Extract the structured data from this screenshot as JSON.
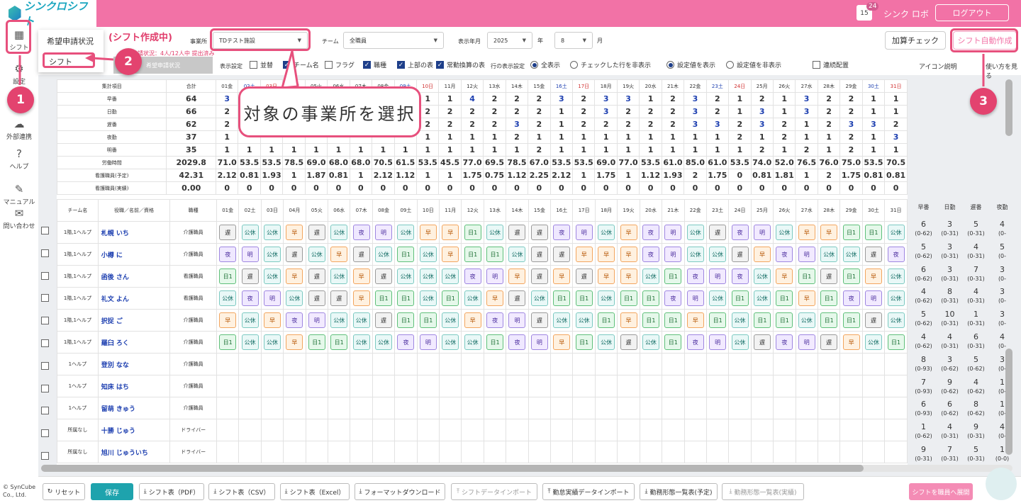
{
  "app": {
    "logo_text": "シンクロシフト",
    "user_name": "シンク ロボ",
    "logout": "ログアウト",
    "notification_count": "24"
  },
  "sidebar": {
    "items": [
      {
        "label": "シフト",
        "icon": "calendar-icon"
      },
      {
        "label": "設定",
        "icon": "gear-icon"
      },
      {
        "label": "外部連携",
        "icon": "cloud-icon"
      },
      {
        "label": "ヘルプ",
        "icon": "help-icon"
      },
      {
        "label": "マニュアル",
        "icon": "pen-icon"
      },
      {
        "label": "問い合わせ",
        "icon": "mail-icon"
      }
    ],
    "copyright_1": "© SynCube",
    "copyright_2": "Co., Ltd."
  },
  "popup": {
    "item1": "希望申請状況",
    "item2": "シフト"
  },
  "header": {
    "page_title": "(シフト作成中)",
    "office_label": "事業所",
    "office_value": "TDテスト施設",
    "team_label": "チーム",
    "team_value": "全職員",
    "month_label": "表示年月",
    "year_value": "2025",
    "year_unit": "年",
    "month_value": "8",
    "month_unit": "月",
    "submit_status": "希望申請状況：4人/12人中 提出済み",
    "sub_tab_inactive": "希望申請状況",
    "display_setting_label": "表示設定",
    "checks": [
      {
        "label": "並替",
        "on": false
      },
      {
        "label": "チーム名",
        "on": true
      },
      {
        "label": "フラグ",
        "on": false
      },
      {
        "label": "職種",
        "on": true
      },
      {
        "label": "上部の表",
        "on": true
      },
      {
        "label": "常勤換算の表",
        "on": true
      }
    ],
    "row_display_label": "行の表示設定",
    "radio_all": "全表示",
    "radio_hide_checked": "チェックした行を非表示",
    "radio_show_set": "設定値を表示",
    "radio_hide_set": "設定値を非表示",
    "consecutive": "連続配置",
    "icon_help": "アイコン説明",
    "how_to": "使い方を見る",
    "btn_calc": "加算チェック",
    "btn_auto": "シフト自動作成"
  },
  "summary": {
    "header_labels": [
      "集計項目",
      "合計"
    ],
    "days": [
      "01金",
      "02土",
      "03日",
      "04月",
      "05火",
      "06水",
      "07木",
      "08金",
      "09土",
      "10日",
      "11月",
      "12火",
      "13水",
      "14木",
      "15金",
      "16土",
      "17日",
      "18月",
      "19火",
      "20水",
      "21木",
      "22金",
      "23土",
      "24日",
      "25月",
      "26火",
      "27水",
      "28木",
      "29金",
      "30土",
      "31日"
    ],
    "rows": [
      {
        "label": "早番",
        "total": "64",
        "vals": [
          "3",
          "",
          "",
          "",
          "",
          "",
          "",
          "",
          "",
          "1",
          "1",
          "4",
          "2",
          "2",
          "2",
          "3",
          "2",
          "3",
          "3",
          "1",
          "2",
          "3",
          "2",
          "1",
          "2",
          "1",
          "3",
          "2",
          "2",
          "1",
          "1"
        ]
      },
      {
        "label": "日勤",
        "total": "66",
        "vals": [
          "2",
          "",
          "",
          "",
          "",
          "",
          "",
          "",
          "",
          "2",
          "2",
          "2",
          "2",
          "2",
          "2",
          "1",
          "2",
          "3",
          "2",
          "2",
          "2",
          "3",
          "2",
          "1",
          "3",
          "1",
          "3",
          "2",
          "2",
          "1",
          "1"
        ]
      },
      {
        "label": "遅番",
        "total": "62",
        "vals": [
          "2",
          "",
          "",
          "",
          "",
          "",
          "",
          "",
          "",
          "2",
          "2",
          "2",
          "2",
          "3",
          "2",
          "1",
          "2",
          "2",
          "2",
          "2",
          "2",
          "3",
          "3",
          "2",
          "3",
          "2",
          "1",
          "2",
          "3",
          "3",
          "2"
        ]
      },
      {
        "label": "夜勤",
        "total": "37",
        "vals": [
          "1",
          "",
          "",
          "",
          "",
          "",
          "",
          "",
          "",
          "1",
          "1",
          "1",
          "1",
          "2",
          "1",
          "1",
          "1",
          "1",
          "1",
          "1",
          "1",
          "1",
          "1",
          "2",
          "1",
          "2",
          "1",
          "1",
          "2",
          "1",
          "3"
        ]
      },
      {
        "label": "明番",
        "total": "35",
        "vals": [
          "1",
          "1",
          "1",
          "1",
          "1",
          "1",
          "1",
          "1",
          "1",
          "1",
          "1",
          "1",
          "1",
          "1",
          "2",
          "1",
          "1",
          "1",
          "1",
          "1",
          "1",
          "1",
          "1",
          "1",
          "2",
          "1",
          "2",
          "1",
          "2",
          "1",
          "1"
        ]
      },
      {
        "label": "労働時間",
        "total": "2029.8",
        "vals": [
          "71.0",
          "53.5",
          "53.5",
          "78.5",
          "69.0",
          "68.0",
          "68.0",
          "70.5",
          "61.5",
          "53.5",
          "45.5",
          "77.0",
          "69.5",
          "78.5",
          "67.0",
          "53.5",
          "53.5",
          "69.0",
          "77.0",
          "53.5",
          "61.0",
          "85.0",
          "61.0",
          "53.5",
          "74.0",
          "52.0",
          "76.5",
          "76.0",
          "75.0",
          "53.5",
          "70.5"
        ]
      },
      {
        "label": "看護職員(予定)",
        "total": "42.31",
        "vals": [
          "2.12",
          "0.81",
          "1.93",
          "1",
          "1.87",
          "0.81",
          "1",
          "2.12",
          "1.12",
          "1",
          "1",
          "1.75",
          "0.75",
          "1.12",
          "2.25",
          "2.12",
          "1",
          "1.75",
          "1",
          "1.12",
          "1.93",
          "2",
          "1.75",
          "0",
          "0.81",
          "1.81",
          "1",
          "2",
          "1.75",
          "0.81",
          "0.81"
        ]
      },
      {
        "label": "看護職員(実績)",
        "total": "0.00",
        "vals": [
          "0",
          "0",
          "0",
          "0",
          "0",
          "0",
          "0",
          "0",
          "0",
          "0",
          "0",
          "0",
          "0",
          "0",
          "0",
          "0",
          "0",
          "0",
          "0",
          "0",
          "0",
          "0",
          "0",
          "0",
          "0",
          "0",
          "0",
          "0",
          "0",
          "0",
          "0"
        ]
      }
    ]
  },
  "staff_header": {
    "team": "チーム名",
    "name": "役職／名前／資格",
    "job": "職種",
    "sums": [
      "早番",
      "日勤",
      "遅番",
      "夜勤"
    ]
  },
  "staff": [
    {
      "team": "1階,1ヘルプ",
      "name": "札幌 いち",
      "job": "介護職員",
      "shifts": [
        "遅",
        "公休",
        "公休",
        "早",
        "遅",
        "公休",
        "夜",
        "明",
        "公休",
        "早",
        "早",
        "日1",
        "公休",
        "遅",
        "遅",
        "夜",
        "明",
        "公休",
        "早",
        "夜",
        "明",
        "公休",
        "遅",
        "夜",
        "明",
        "公休",
        "早",
        "早",
        "日1",
        "日1",
        "公休"
      ],
      "sums": [
        [
          "6",
          "(0-62)"
        ],
        [
          "3",
          "(0-31)"
        ],
        [
          "5",
          "(0-31)"
        ],
        [
          "4",
          "(0-"
        ]
      ]
    },
    {
      "team": "1階,1ヘルプ",
      "name": "小樽 に",
      "job": "介護職員",
      "shifts": [
        "夜",
        "明",
        "公休",
        "遅",
        "公休",
        "早",
        "遅",
        "公休",
        "日1",
        "公休",
        "早",
        "日1",
        "日1",
        "公休",
        "遅",
        "遅",
        "早",
        "早",
        "早",
        "夜",
        "明",
        "公休",
        "公休",
        "遅",
        "早",
        "夜",
        "明",
        "公休",
        "公休",
        "遅",
        "夜"
      ],
      "sums": [
        [
          "5",
          "(0-62)"
        ],
        [
          "3",
          "(0-31)"
        ],
        [
          "4",
          "(0-31)"
        ],
        [
          "5",
          "(0-"
        ]
      ]
    },
    {
      "team": "1階,1ヘルプ",
      "name": "函後 さん",
      "job": "看護職員",
      "shifts": [
        "日1",
        "遅",
        "公休",
        "早",
        "遅",
        "公休",
        "早",
        "遅",
        "公休",
        "公休",
        "公休",
        "夜",
        "明",
        "早",
        "遅",
        "早",
        "遅",
        "早",
        "早",
        "公休",
        "日1",
        "夜",
        "明",
        "夜",
        "公休",
        "早",
        "日1",
        "遅",
        "日1",
        "早",
        "公休"
      ],
      "sums": [
        [
          "6",
          "(0-62)"
        ],
        [
          "3",
          "(0-31)"
        ],
        [
          "7",
          "(0-31)"
        ],
        [
          "3",
          "(0-"
        ]
      ]
    },
    {
      "team": "1階,1ヘルプ",
      "name": "礼文 よん",
      "job": "看護職員",
      "shifts": [
        "公休",
        "夜",
        "明",
        "公休",
        "遅",
        "遅",
        "早",
        "日1",
        "日1",
        "公休",
        "日1",
        "公休",
        "早",
        "遅",
        "公休",
        "日1",
        "日1",
        "公休",
        "日1",
        "日1",
        "夜",
        "明",
        "公休",
        "日1",
        "公休",
        "日1",
        "早",
        "日1",
        "夜",
        "明",
        "公休"
      ],
      "sums": [
        [
          "4",
          "(0-62)"
        ],
        [
          "8",
          "(0-31)"
        ],
        [
          "4",
          "(0-31)"
        ],
        [
          "3",
          "(0-"
        ]
      ]
    },
    {
      "team": "1階,1ヘルプ",
      "name": "択捉 ご",
      "job": "介護職員",
      "shifts": [
        "早",
        "公休",
        "早",
        "夜",
        "明",
        "公休",
        "公休",
        "遅",
        "日1",
        "日1",
        "公休",
        "早",
        "夜",
        "明",
        "遅",
        "公休",
        "公休",
        "日1",
        "早",
        "日1",
        "日1",
        "早",
        "日1",
        "公休",
        "日1",
        "日1",
        "公休",
        "日1",
        "日1",
        "遅",
        "公休"
      ],
      "sums": [
        [
          "5",
          "(0-62)"
        ],
        [
          "10",
          "(0-31)"
        ],
        [
          "1",
          "(0-31)"
        ],
        [
          "3",
          "(0-"
        ]
      ]
    },
    {
      "team": "1階,1ヘルプ",
      "name": "羅臼 ろく",
      "job": "介護職員",
      "shifts": [
        "日1",
        "公休",
        "公休",
        "早",
        "日1",
        "日1",
        "公休",
        "公休",
        "夜",
        "明",
        "公休",
        "公休",
        "日1",
        "夜",
        "明",
        "早",
        "日1",
        "公休",
        "遅",
        "公休",
        "日1",
        "夜",
        "明",
        "公休",
        "遅",
        "夜",
        "明",
        "遅",
        "早",
        "公休",
        "日1"
      ],
      "sums": [
        [
          "4",
          "(0-62)"
        ],
        [
          "4",
          "(0-31)"
        ],
        [
          "6",
          "(0-31)"
        ],
        [
          "4",
          "(0-"
        ]
      ]
    }
  ],
  "right_extra_rows": [
    [
      [
        "8",
        "(0-93)"
      ],
      [
        "3",
        "(0-62)"
      ],
      [
        "5",
        "(0-62)"
      ],
      [
        "3",
        "(0-"
      ]
    ],
    [
      [
        "7",
        "(0-93)"
      ],
      [
        "9",
        "(0-62)"
      ],
      [
        "4",
        "(0-62)"
      ],
      [
        "1",
        "(0-"
      ]
    ],
    [
      [
        "6",
        "(0-93)"
      ],
      [
        "6",
        "(0-62)"
      ],
      [
        "8",
        "(0-62)"
      ],
      [
        "1",
        "(0-"
      ]
    ],
    [
      [
        "1",
        "(0-62)"
      ],
      [
        "4",
        "(0-31)"
      ],
      [
        "9",
        "(0-31)"
      ],
      [
        "4",
        "(0-"
      ]
    ],
    [
      [
        "9",
        "(0-31)"
      ],
      [
        "7",
        "(0-31)"
      ],
      [
        "5",
        "(0-31)"
      ],
      [
        "1",
        "(0-0)"
      ]
    ]
  ],
  "extra_staff": [
    {
      "team": "1ヘルプ",
      "name": "登別 なな",
      "job": "介護職員"
    },
    {
      "team": "1ヘルプ",
      "name": "知床 はち",
      "job": "介護職員"
    },
    {
      "team": "1ヘルプ",
      "name": "留萌 きゅう",
      "job": "介護職員"
    },
    {
      "team": "所属なし",
      "name": "十勝 じゅう",
      "job": "ドライバー"
    },
    {
      "team": "所属なし",
      "name": "旭川 じゅういち",
      "job": "ドライバー"
    }
  ],
  "footer": {
    "reset": "リセット",
    "save": "保存",
    "pdf": "シフト表（PDF）",
    "csv": "シフト表（CSV）",
    "excel": "シフト表（Excel）",
    "format_dl": "フォーマットダウンロード",
    "shift_import": "シフトデータインポート",
    "attendance_import": "勤怠実績データインポート",
    "form_plan": "勤務形態一覧表(予定)",
    "form_actual": "勤務形態一覧表(実績)",
    "expand": "シフトを職員へ展開"
  },
  "annotations": {
    "callout": "対象の事業所を選択",
    "step1": "1",
    "step2": "2",
    "step3": "3"
  }
}
